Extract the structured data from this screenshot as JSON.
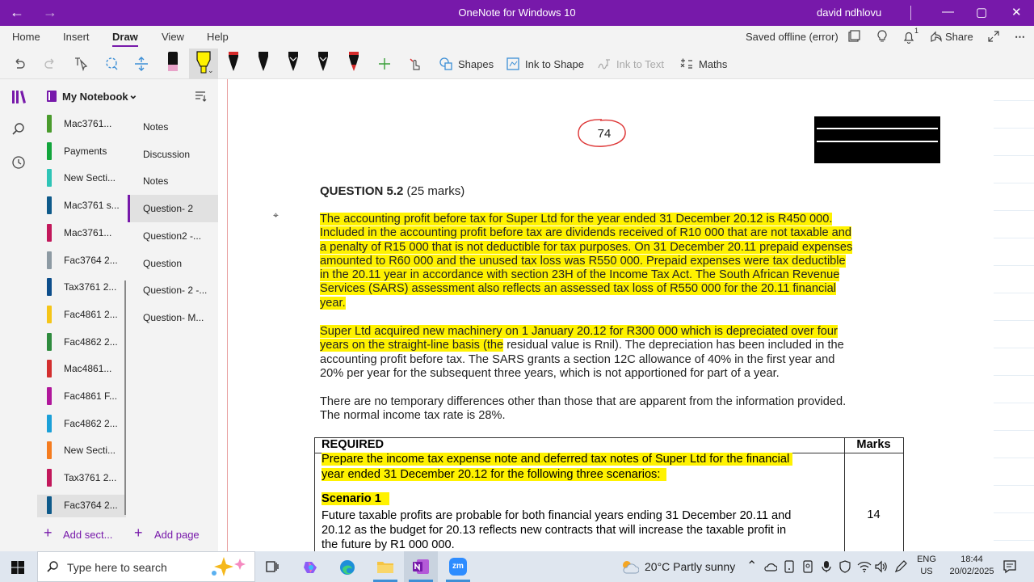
{
  "titlebar": {
    "app_title": "OneNote for Windows 10",
    "user": "david ndhlovu",
    "back": "←",
    "forward": "→",
    "minimize": "—",
    "maximize": "▢",
    "close": "✕"
  },
  "menu": {
    "tabs": [
      "Home",
      "Insert",
      "Draw",
      "View",
      "Help"
    ],
    "active_tab": "Draw",
    "status": "Saved offline (error)",
    "share": "Share",
    "notifications_count": "1"
  },
  "toolbar": {
    "shapes": "Shapes",
    "ink_to_shape": "Ink to Shape",
    "ink_to_text": "Ink to Text",
    "maths": "Maths"
  },
  "notebook": {
    "name": "My Notebook",
    "sections": [
      {
        "label": "Mac3761...",
        "color": "#4a9b2d"
      },
      {
        "label": "Payments",
        "color": "#12a53c"
      },
      {
        "label": "New Secti...",
        "color": "#2ec4b6"
      },
      {
        "label": "Mac3761 s...",
        "color": "#0e5a8a"
      },
      {
        "label": "Mac3761...",
        "color": "#c2185b"
      },
      {
        "label": "Fac3764 2...",
        "color": "#8d9aa3"
      },
      {
        "label": "Tax3761 2...",
        "color": "#0d4e8b"
      },
      {
        "label": "Fac4861 2...",
        "color": "#f5c518"
      },
      {
        "label": "Fac4862 2...",
        "color": "#2e8b3e"
      },
      {
        "label": "Mac4861...",
        "color": "#d32f2f"
      },
      {
        "label": "Fac4861 F...",
        "color": "#b0179b"
      },
      {
        "label": "Fac4862 2...",
        "color": "#1ba0d8"
      },
      {
        "label": "New Secti...",
        "color": "#f57c1f"
      },
      {
        "label": "Tax3761 2...",
        "color": "#c2185b"
      },
      {
        "label": "Fac3764 2...",
        "color": "#0e5a8a"
      }
    ],
    "active_section_index": 14,
    "pages": [
      "Notes",
      "Discussion",
      "Notes",
      "Question- 2",
      "Question2 -...",
      "Question",
      "Question- 2 -...",
      "Question- M..."
    ],
    "active_page_index": 3,
    "add_section": "Add sect...",
    "add_page": "Add page"
  },
  "document": {
    "page_number": "74",
    "question_title": "QUESTION 5.2",
    "question_marks": "(25 marks)",
    "para1_lines": [
      "The accounting profit before tax for Super Ltd for the year ended 31 December 20.12 is R450 000.",
      "Included in the accounting profit before tax are dividends received of R10 000 that are not taxable and",
      "a penalty of R15 000 that is not deductible for tax purposes. On 31 December 20.11 prepaid expenses",
      "amounted to R60 000 and the unused tax loss was R550 000. Prepaid expenses were tax deductible",
      "in the 20.11 year in accordance with section 23H of the Income Tax Act. The South African Revenue",
      "Services (SARS) assessment also reflects an assessed tax loss of R550 000 for the 20.11 financial",
      "year."
    ],
    "para2_line1": "Super Ltd acquired new machinery on 1 January 20.12 for R300 000 which is depreciated over four",
    "para2_line2_hl": "years on the straight-line basis (the",
    "para2_line2_rest": " residual value is Rnil). The depreciation has been included in the",
    "para2_rest_lines": [
      "accounting profit before tax. The SARS grants a section 12C allowance of 40% in the first year and",
      "20% per year for the subsequent three years, which is not apportioned for part of a year."
    ],
    "para3_lines": [
      "There are no temporary differences other than those that are apparent from the information provided.",
      "The normal income tax rate is 28%."
    ],
    "required_header": "REQUIRED",
    "marks_header": "Marks",
    "required_lines": [
      "Prepare the income tax expense note and deferred tax notes of Super Ltd for the financial",
      "year ended 31 December 20.12 for the following three scenarios:"
    ],
    "scenario_title": "Scenario 1",
    "scenario_lines": [
      "Future taxable profits are probable for both financial years ending 31 December 20.11 and",
      "20.12 as the budget for 20.13 reflects new contracts that will increase the taxable profit in",
      "the future by R1 000 000."
    ],
    "scenario_marks": "14"
  },
  "taskbar": {
    "search_placeholder": "Type here to search",
    "weather": "20°C  Partly sunny",
    "lang_line1": "ENG",
    "lang_line2": "US",
    "time": "18:44",
    "date": "20/02/2025",
    "zoom_label": "zm"
  }
}
